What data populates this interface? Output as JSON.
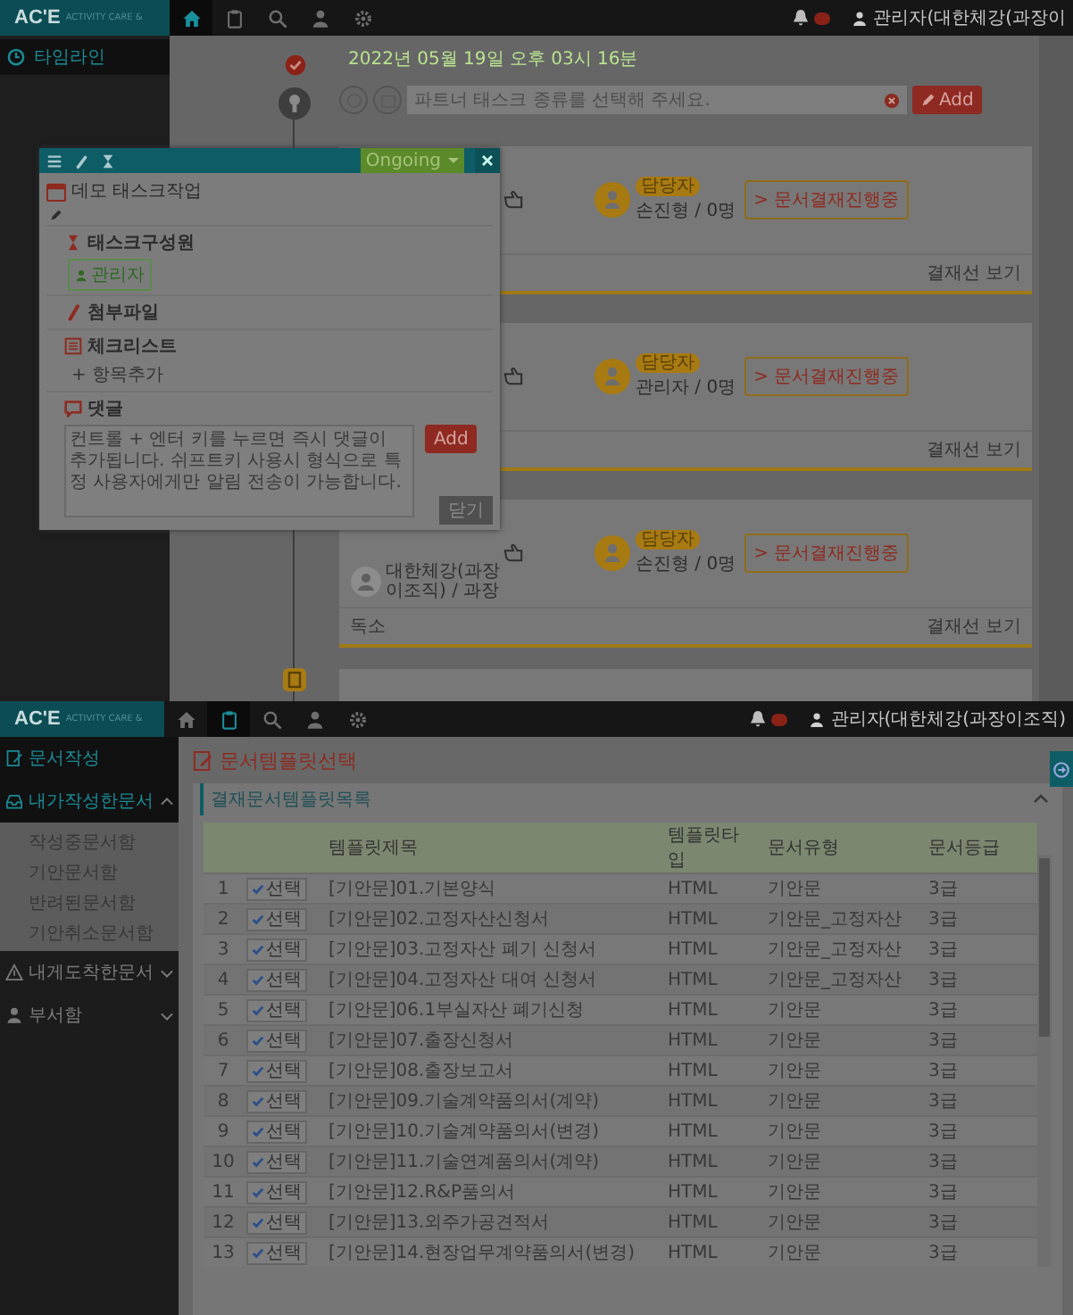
{
  "top": {
    "header": {
      "logo": "AC'E",
      "logo_tagline": "ACTIVITY CARE &",
      "nav": [
        {
          "selected": true
        },
        {
          "selected": false
        },
        {
          "selected": false
        },
        {
          "selected": false
        },
        {
          "selected": false
        }
      ],
      "alert_badge": true,
      "user": "관리자(대한체강(과장이"
    },
    "sidebar": {
      "items": [
        {
          "label": "타임라인",
          "selected": true
        }
      ]
    },
    "timeline": {
      "date": "2022년 05월 19일 오후 03시 16분",
      "task_placeholder": "파트너 태스크 종류를 선택해 주세요.",
      "add_button": "Add"
    },
    "cards": [
      {
        "assignee_badge": "담당자",
        "assignee": "손진형 / 0명",
        "doc_button": "> 문서결재진행중",
        "footer_link": "결재선 보기"
      },
      {
        "assignee_badge": "담당자",
        "assignee": "관리자 / 0명",
        "doc_button": "> 문서결재진행중",
        "footer_link": "결재선 보기"
      },
      {
        "author": "대한체강(과장이조직) / 과장",
        "assignee_badge": "담당자",
        "assignee": "손진형 / 0명",
        "doc_button": "> 문서결재진행중",
        "note": "독소",
        "footer_link": "결재선 보기"
      }
    ],
    "popup": {
      "status": "Ongoing",
      "title": "데모 태스크작업",
      "sections": [
        {
          "kind": "members",
          "label": "태스크구성원",
          "chips": [
            "관리자"
          ]
        },
        {
          "kind": "attachments",
          "label": "첨부파일"
        },
        {
          "kind": "checklist",
          "label": "체크리스트",
          "add_item": "+ 항목추가"
        },
        {
          "kind": "comments",
          "label": "댓글",
          "placeholder": "컨트롤 + 엔터 키를 누르면 즉시 댓글이 추가됩니다. 쉬프트키 사용시 형식으로 특정 사용자에게만 알림 전송이 가능합니다.",
          "add_button": "Add"
        }
      ],
      "close_button": "닫기"
    }
  },
  "bottom": {
    "header": {
      "logo": "AC'E",
      "logo_tagline": "ACTIVITY CARE &",
      "nav": [
        {
          "selected": false
        },
        {
          "selected": true
        },
        {
          "selected": false
        },
        {
          "selected": false
        },
        {
          "selected": false
        }
      ],
      "alert_badge": true,
      "user": "관리자(대한체강(과장이조직)"
    },
    "sidebar": {
      "items": [
        {
          "label": "문서작성",
          "selected": true
        },
        {
          "label": "내가작성한문서",
          "selected": true,
          "expanded": true,
          "children": [
            {
              "label": "작성중문서함"
            },
            {
              "label": "기안문서함"
            },
            {
              "label": "반려된문서함"
            },
            {
              "label": "기안취소문서함"
            }
          ]
        },
        {
          "label": "내게도착한문서",
          "selected": false,
          "expanded": false
        },
        {
          "label": "부서함",
          "selected": false,
          "expanded": false
        }
      ]
    },
    "page_title": "문서템플릿선택",
    "panel_title": "결재문서템플릿목록",
    "table": {
      "columns": [
        "템플릿제목",
        "템플릿타입",
        "문서유형",
        "문서등급"
      ],
      "rows": [
        {
          "no": "1",
          "select": "선택",
          "title": "[기안문]01.기본양식",
          "type": "HTML",
          "doc_type": "기안문",
          "grade": "3급"
        },
        {
          "no": "2",
          "select": "선택",
          "title": "[기안문]02.고정자산신청서",
          "type": "HTML",
          "doc_type": "기안문_고정자산",
          "grade": "3급"
        },
        {
          "no": "3",
          "select": "선택",
          "title": "[기안문]03.고정자산 폐기 신청서",
          "type": "HTML",
          "doc_type": "기안문_고정자산",
          "grade": "3급"
        },
        {
          "no": "4",
          "select": "선택",
          "title": "[기안문]04.고정자산 대여 신청서",
          "type": "HTML",
          "doc_type": "기안문_고정자산",
          "grade": "3급"
        },
        {
          "no": "5",
          "select": "선택",
          "title": "[기안문]06.1부실자산 폐기신청",
          "type": "HTML",
          "doc_type": "기안문",
          "grade": "3급"
        },
        {
          "no": "6",
          "select": "선택",
          "title": "[기안문]07.출장신청서",
          "type": "HTML",
          "doc_type": "기안문",
          "grade": "3급"
        },
        {
          "no": "7",
          "select": "선택",
          "title": "[기안문]08.출장보고서",
          "type": "HTML",
          "doc_type": "기안문",
          "grade": "3급"
        },
        {
          "no": "8",
          "select": "선택",
          "title": "[기안문]09.기술계약품의서(계약)",
          "type": "HTML",
          "doc_type": "기안문",
          "grade": "3급"
        },
        {
          "no": "9",
          "select": "선택",
          "title": "[기안문]10.기술계약품의서(변경)",
          "type": "HTML",
          "doc_type": "기안문",
          "grade": "3급"
        },
        {
          "no": "10",
          "select": "선택",
          "title": "[기안문]11.기술연계품의서(계약)",
          "type": "HTML",
          "doc_type": "기안문",
          "grade": "3급"
        },
        {
          "no": "11",
          "select": "선택",
          "title": "[기안문]12.R&P품의서",
          "type": "HTML",
          "doc_type": "기안문",
          "grade": "3급"
        },
        {
          "no": "12",
          "select": "선택",
          "title": "[기안문]13.외주가공견적서",
          "type": "HTML",
          "doc_type": "기안문",
          "grade": "3급"
        },
        {
          "no": "13",
          "select": "선택",
          "title": "[기안문]14.현장업무계약품의서(변경)",
          "type": "HTML",
          "doc_type": "기안문",
          "grade": "3급"
        }
      ]
    }
  }
}
